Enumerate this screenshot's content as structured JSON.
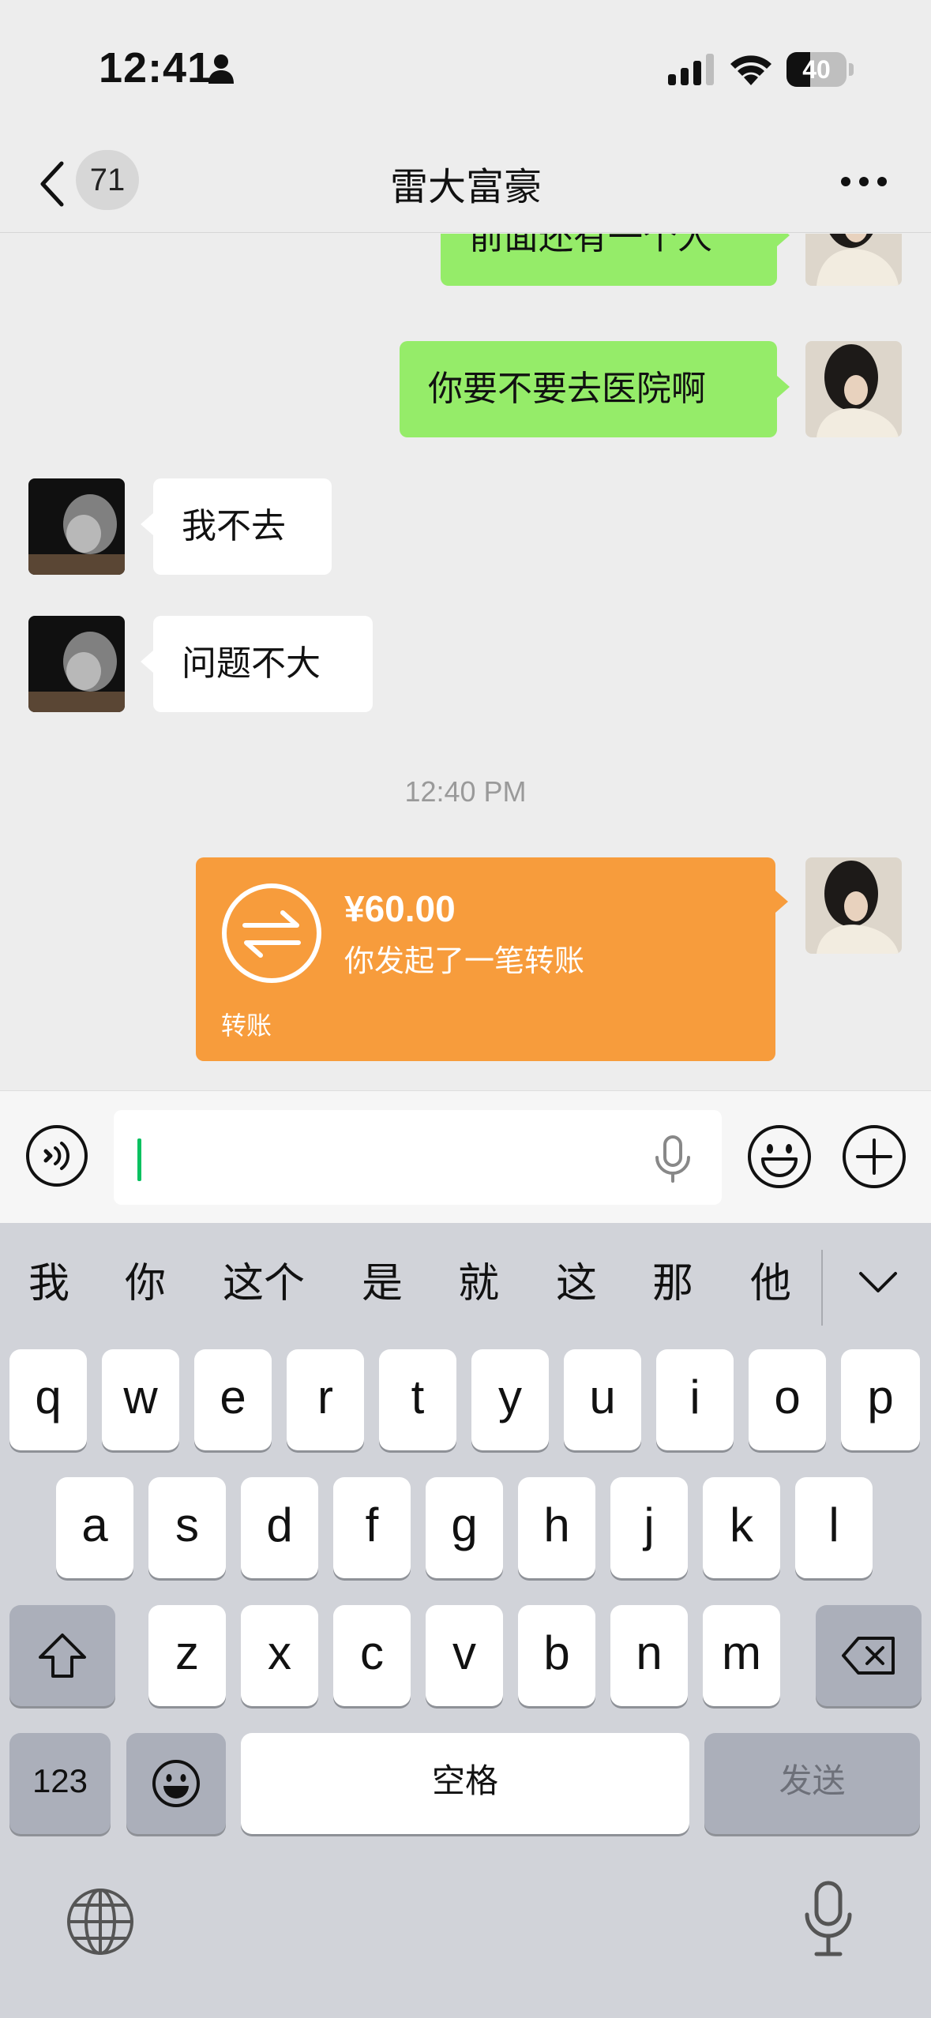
{
  "status_bar": {
    "time": "12:41",
    "battery": "40",
    "battery_level": 0.4,
    "icons": [
      "person-icon",
      "cellular-signal-icon",
      "wifi-icon",
      "battery-icon"
    ]
  },
  "nav": {
    "unread_count": "71",
    "title": "雷大富豪",
    "icons": [
      "back-chevron-icon",
      "more-icon"
    ]
  },
  "messages": [
    {
      "side": "me",
      "text": "前面还有一个人"
    },
    {
      "side": "me",
      "text": "你要不要去医院啊"
    },
    {
      "side": "them",
      "text": "我不去"
    },
    {
      "side": "them",
      "text": "问题不大"
    }
  ],
  "timestamp": "12:40 PM",
  "transfer": {
    "amount": "¥60.00",
    "description": "你发起了一笔转账",
    "label": "转账",
    "color": "#f79c3c"
  },
  "input": {
    "value": "",
    "icons": [
      "voice-icon",
      "microphone-icon",
      "emoji-icon",
      "plus-icon"
    ]
  },
  "keyboard": {
    "candidates": [
      "我",
      "你",
      "这个",
      "是",
      "就",
      "这",
      "那",
      "他"
    ],
    "row1": [
      "q",
      "w",
      "e",
      "r",
      "t",
      "y",
      "u",
      "i",
      "o",
      "p"
    ],
    "row2": [
      "a",
      "s",
      "d",
      "f",
      "g",
      "h",
      "j",
      "k",
      "l"
    ],
    "row3": [
      "z",
      "x",
      "c",
      "v",
      "b",
      "n",
      "m"
    ],
    "numbers_key": "123",
    "space_key": "空格",
    "send_key": "发送",
    "icons": [
      "shift-icon",
      "backspace-icon",
      "emoji-key-icon",
      "globe-icon",
      "dictation-mic-icon",
      "chevron-down-icon"
    ]
  },
  "colors": {
    "my_bubble": "#95ec69",
    "their_bubble": "#ffffff",
    "background": "#ededed",
    "caret": "#07c160"
  }
}
